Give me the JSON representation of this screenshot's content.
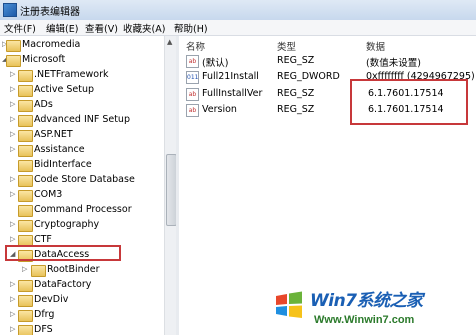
{
  "window": {
    "title": "注册表编辑器"
  },
  "menu": [
    "文件(F)",
    "编辑(E)",
    "查看(V)",
    "收藏夹(A)",
    "帮助(H)"
  ],
  "tree": [
    {
      "label": "Macromedia",
      "expand": "▷"
    },
    {
      "label": "Microsoft",
      "expand": "◢"
    },
    {
      "label": ".NETFramework",
      "expand": "▷"
    },
    {
      "label": "Active Setup",
      "expand": "▷"
    },
    {
      "label": "ADs",
      "expand": "▷"
    },
    {
      "label": "Advanced INF Setup",
      "expand": "▷"
    },
    {
      "label": "ASP.NET",
      "expand": "▷"
    },
    {
      "label": "Assistance",
      "expand": "▷"
    },
    {
      "label": "BidInterface",
      "expand": ""
    },
    {
      "label": "Code Store Database",
      "expand": "▷"
    },
    {
      "label": "COM3",
      "expand": "▷"
    },
    {
      "label": "Command Processor",
      "expand": ""
    },
    {
      "label": "Cryptography",
      "expand": "▷"
    },
    {
      "label": "CTF",
      "expand": "▷"
    },
    {
      "label": "DataAccess",
      "expand": "◢"
    },
    {
      "label": "RootBinder",
      "expand": "▷"
    },
    {
      "label": "DataFactory",
      "expand": "▷"
    },
    {
      "label": "DevDiv",
      "expand": "▷"
    },
    {
      "label": "Dfrg",
      "expand": "▷"
    },
    {
      "label": "DFS",
      "expand": "▷"
    }
  ],
  "columns": {
    "name": "名称",
    "type": "类型",
    "data": "数据"
  },
  "values": [
    {
      "name": "(默认)",
      "type": "REG_SZ",
      "data": "(数值未设置)",
      "icon": "ab"
    },
    {
      "name": "Full21Install",
      "type": "REG_DWORD",
      "data": "0xffffffff (4294967295)",
      "icon": "011"
    },
    {
      "name": "FullInstallVer",
      "type": "REG_SZ",
      "data": "6.1.7601.17514",
      "icon": "ab"
    },
    {
      "name": "Version",
      "type": "REG_SZ",
      "data": "6.1.7601.17514",
      "icon": "ab"
    }
  ],
  "watermark": {
    "brand": "Win7系统之家",
    "url": "Www.Winwin7.com"
  }
}
